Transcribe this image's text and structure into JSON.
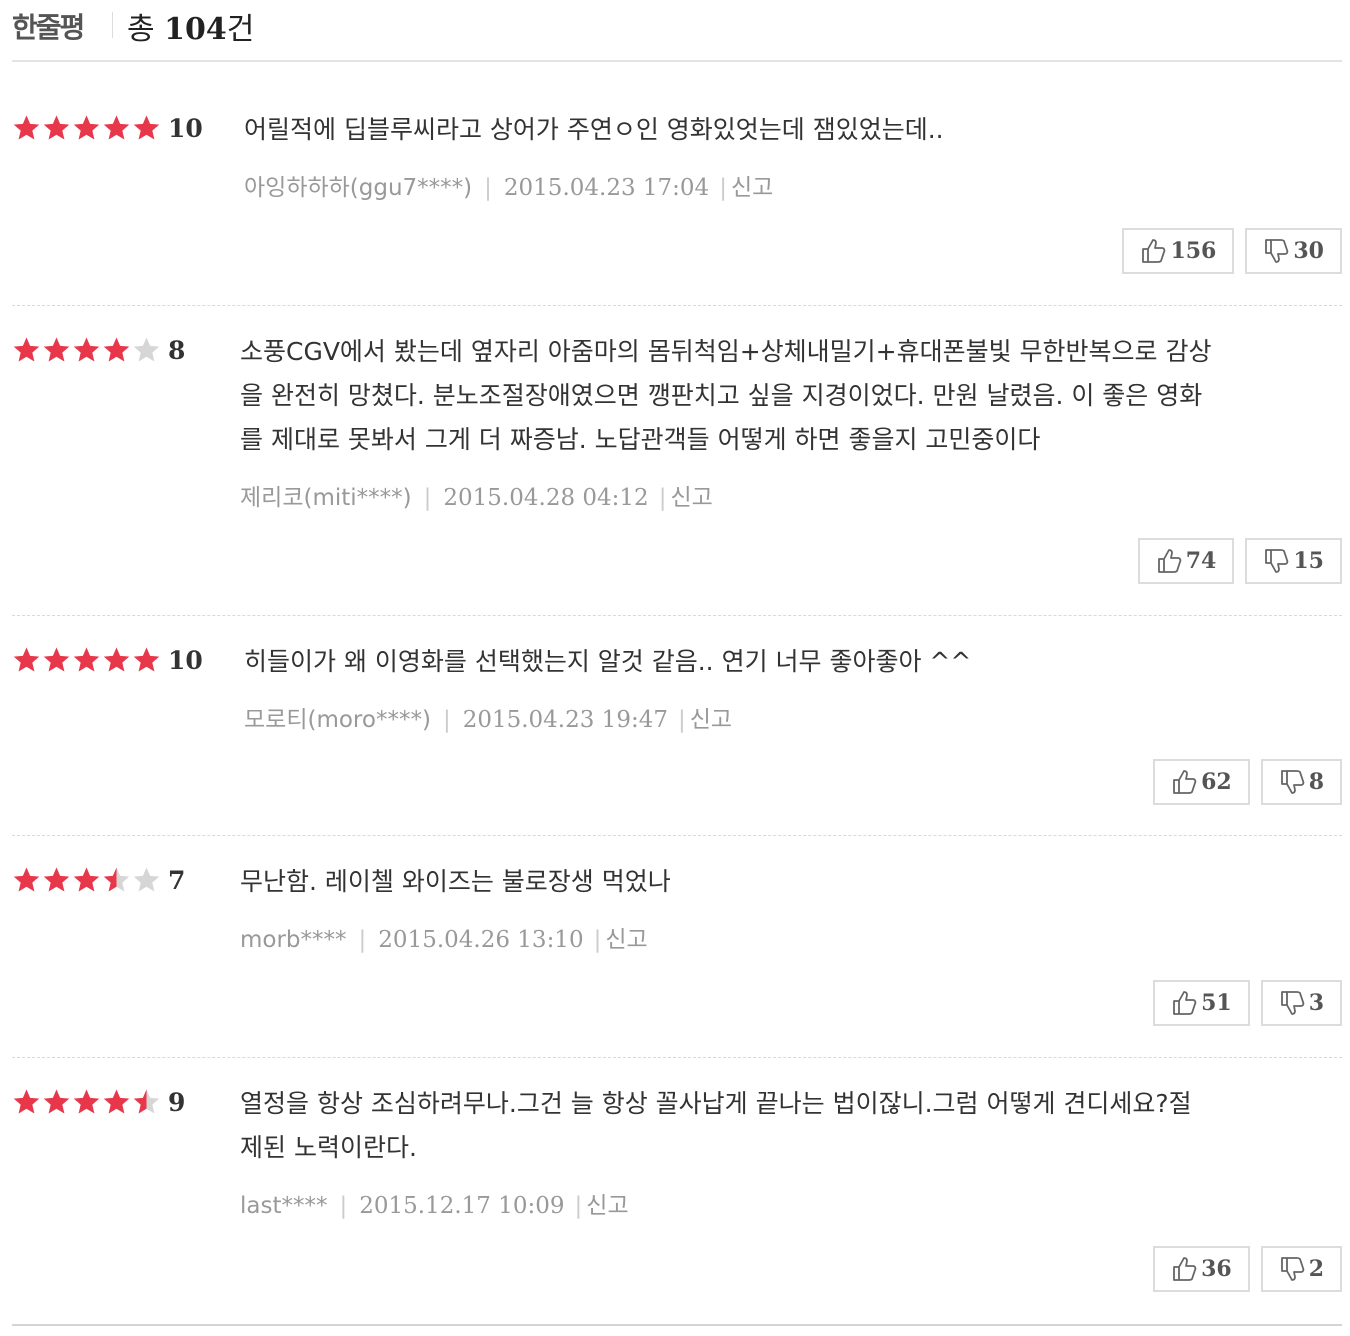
{
  "header": {
    "title": "한줄평",
    "total_prefix": "총 ",
    "total_count": "104",
    "total_suffix": "건"
  },
  "reviews": [
    {
      "stars": 5,
      "score": "10",
      "text_lines": [
        "어릴적에 딥블루씨라고 상어가 주연ㅇ인 영화있엇는데 잼있었는데.."
      ],
      "author": "아잉하하하(ggu7****)",
      "date": "2015.04.23 17:04",
      "report": "신고",
      "likes": "156",
      "dislikes": "30"
    },
    {
      "stars": 4,
      "score": "8",
      "text_lines": [
        "소풍CGV에서 봤는데 옆자리 아줌마의 몸뒤척임+상체내밀기+휴대폰불빛 무한반복으로 감상",
        "을 완전히 망쳤다. 분노조절장애였으면 깽판치고 싶을 지경이었다. 만원 날렸음. 이 좋은 영화",
        "를 제대로 못봐서 그게 더 짜증남. 노답관객들 어떻게 하면 좋을지 고민중이다"
      ],
      "author": "제리코(miti****)",
      "date": "2015.04.28 04:12",
      "report": "신고",
      "likes": "74",
      "dislikes": "15"
    },
    {
      "stars": 5,
      "score": "10",
      "text_lines": [
        "히들이가 왜 이영화를 선택했는지 알것 같음.. 연기 너무 좋아좋아 ^^"
      ],
      "author": "모로티(moro****)",
      "date": "2015.04.23 19:47",
      "report": "신고",
      "likes": "62",
      "dislikes": "8"
    },
    {
      "stars": 3.5,
      "score": "7",
      "text_lines": [
        "무난함. 레이첼 와이즈는 불로장생 먹었나"
      ],
      "author": "morb****",
      "date": "2015.04.26 13:10",
      "report": "신고",
      "likes": "51",
      "dislikes": "3"
    },
    {
      "stars": 4.5,
      "score": "9",
      "text_lines": [
        "열정을 항상 조심하려무나.그건 늘 항상 꼴사납게 끝나는 법이잖니.그럼 어떻게 견디세요?절",
        "제된 노력이란다."
      ],
      "author": "last****",
      "date": "2015.12.17 10:09",
      "report": "신고",
      "likes": "36",
      "dislikes": "2"
    }
  ],
  "colors": {
    "star_on": "#e8374a",
    "star_off": "#d6d6d6"
  },
  "icons": {
    "like": "thumbs-up-icon",
    "dislike": "thumbs-down-icon",
    "star": "star-icon"
  }
}
